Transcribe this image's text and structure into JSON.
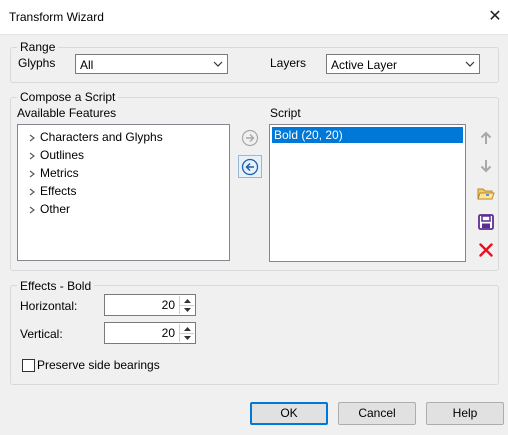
{
  "window": {
    "title": "Transform Wizard",
    "close_glyph": "✕"
  },
  "range": {
    "group_label": "Range",
    "glyphs_label": "Glyphs",
    "glyphs_value": "All",
    "layers_label": "Layers",
    "layers_value": "Active Layer"
  },
  "compose": {
    "group_label": "Compose a Script",
    "available_label": "Available Features",
    "features": [
      {
        "label": "Characters and Glyphs"
      },
      {
        "label": "Outlines"
      },
      {
        "label": "Metrics"
      },
      {
        "label": "Effects"
      },
      {
        "label": "Other"
      }
    ],
    "script_label": "Script",
    "script_items": [
      {
        "label": "Bold (20, 20)",
        "selected": true
      }
    ],
    "icons": {
      "add": "arrow-right-circle-icon",
      "remove": "arrow-left-circle-icon",
      "move_up": "arrow-up-icon",
      "move_down": "arrow-down-icon",
      "open": "open-folder-icon",
      "save": "save-disk-icon",
      "delete": "delete-x-icon"
    }
  },
  "effects": {
    "group_label": "Effects - Bold",
    "horizontal_label": "Horizontal:",
    "horizontal_value": "20",
    "vertical_label": "Vertical:",
    "vertical_value": "20",
    "preserve_label": "Preserve side bearings",
    "preserve_checked": false
  },
  "buttons": {
    "ok": "OK",
    "cancel": "Cancel",
    "help": "Help"
  },
  "colors": {
    "selection": "#0078d7",
    "delete": "#e81123",
    "save": "#5c2d91",
    "arrow_disabled": "#a0a0a0"
  }
}
